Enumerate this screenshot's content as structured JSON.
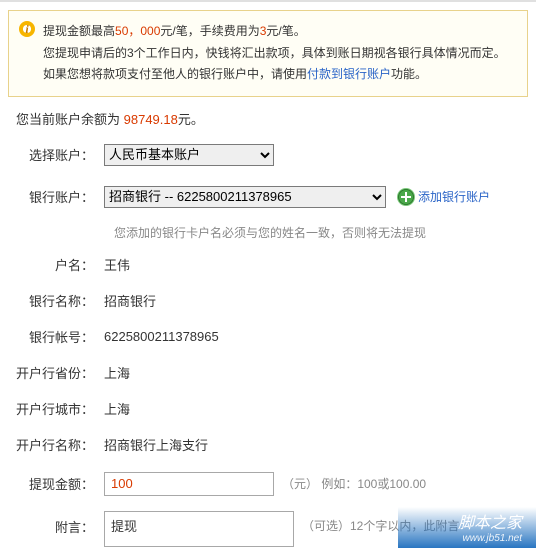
{
  "notice": {
    "line1_a": "提现金额最高",
    "line1_amt": "50，000",
    "line1_b": "元/笔，手续费用为",
    "line1_fee": "3",
    "line1_c": "元/笔。",
    "line2": "您提现申请后的3个工作日内，快钱将汇出款项，具体到账日期视各银行具体情况而定。",
    "line3_a": "如果您想将款项支付至他人的银行账户中，请使用",
    "line3_link": "付款到银行账户",
    "line3_b": "功能。"
  },
  "balance": {
    "prefix": "您当前账户余额为 ",
    "amount": "98749.18",
    "suffix": "元。"
  },
  "labels": {
    "select_account": "选择账户：",
    "bank_account": "银行账户：",
    "add_bank": "添加银行账户",
    "hint_name": "您添加的银行卡户名必须与您的姓名一致，否则将无法提现",
    "holder": "户名：",
    "bank_name": "银行名称：",
    "bank_number": "银行帐号：",
    "province": "开户行省份：",
    "city": "开户行城市：",
    "branch": "开户行名称：",
    "amount": "提现金额：",
    "amount_hint": "（元） 例如：100或100.00",
    "message": "附言：",
    "message_hint": "（可选）12个字以内，此附言"
  },
  "selects": {
    "account_display": "人民币基本账户",
    "bank_display": "招商银行  -- 6225800211378965"
  },
  "details": {
    "holder": "王伟",
    "bank_name": "招商银行",
    "bank_number": "6225800211378965",
    "province": "上海",
    "city": "上海",
    "branch": "招商银行上海支行"
  },
  "inputs": {
    "amount_value": "100",
    "message_value": "提现"
  },
  "watermark": {
    "title": "脚本之家",
    "url": "www.jb51.net"
  }
}
